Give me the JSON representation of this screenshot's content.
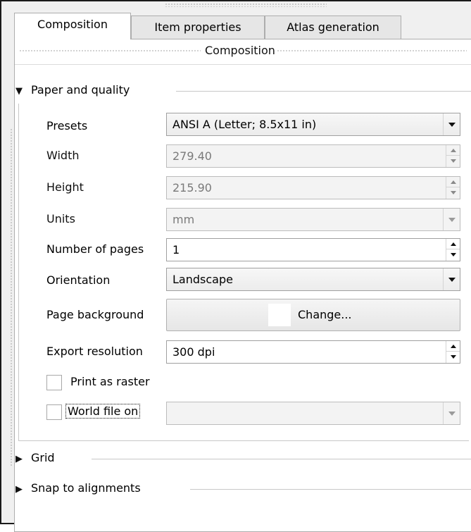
{
  "tabs": [
    {
      "label": "Composition",
      "active": true
    },
    {
      "label": "Item properties",
      "active": false
    },
    {
      "label": "Atlas generation",
      "active": false
    }
  ],
  "section_title": "Composition",
  "paper_group": {
    "title": "Paper and quality",
    "expanded": true,
    "presets": {
      "label": "Presets",
      "value": "ANSI A (Letter; 8.5x11 in)"
    },
    "width": {
      "label": "Width",
      "value": "279.40"
    },
    "height": {
      "label": "Height",
      "value": "215.90"
    },
    "units": {
      "label": "Units",
      "value": "mm"
    },
    "pages": {
      "label": "Number of pages",
      "value": "1"
    },
    "orientation": {
      "label": "Orientation",
      "value": "Landscape"
    },
    "background": {
      "label": "Page background",
      "button_label": "Change...",
      "swatch_color": "#ffffff"
    },
    "resolution": {
      "label": "Export resolution",
      "value": "300 dpi"
    },
    "print_raster": {
      "label": "Print as raster",
      "checked": false
    },
    "world_file": {
      "label": "World file on",
      "checked": false,
      "value": ""
    }
  },
  "grid_group": {
    "title": "Grid",
    "expanded": false
  },
  "snap_group": {
    "title": "Snap to alignments",
    "expanded": false
  },
  "icons": {
    "expanded": "triangle-down-icon",
    "collapsed": "triangle-right-icon",
    "dropdown": "chevron-down-icon",
    "spin": "spin-arrows-icon"
  }
}
